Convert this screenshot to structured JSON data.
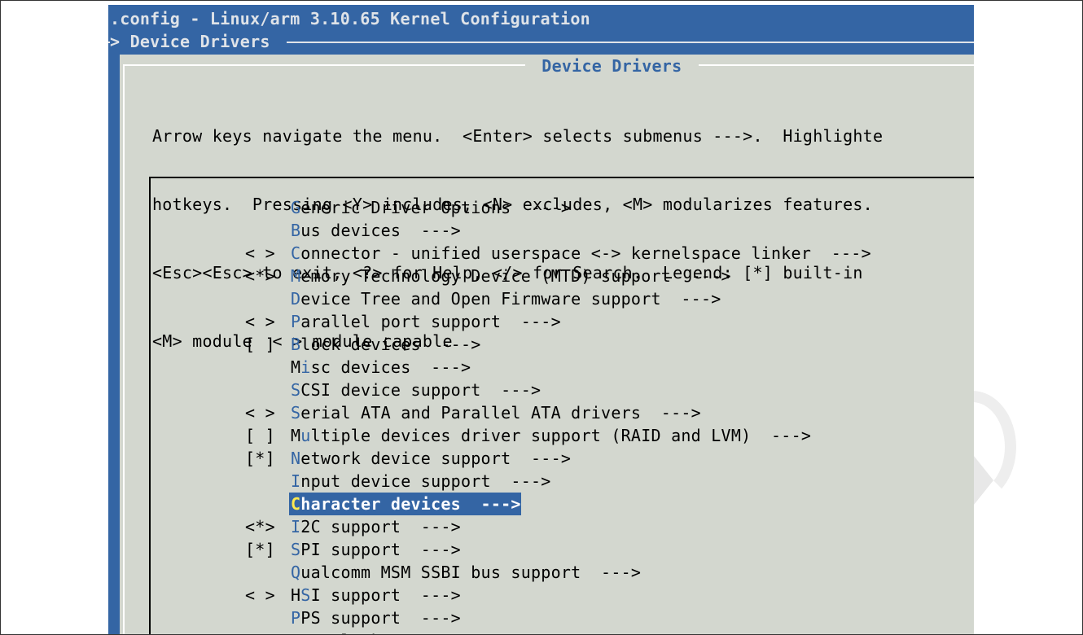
{
  "window": {
    "title": ".config - Linux/arm 3.10.65 Kernel Configuration",
    "breadcrumb": "> Device Drivers "
  },
  "dialog": {
    "title": " Device Drivers ",
    "help_lines": [
      "Arrow keys navigate the menu.  <Enter> selects submenus --->.  Highlighte",
      "hotkeys.  Pressing <Y> includes, <N> excludes, <M> modularizes features.",
      "<Esc><Esc> to exit, <?> for Help, </> for Search.  Legend: [*] built-in",
      "<M> module  < > module capable"
    ]
  },
  "menu": {
    "selected_index": 13,
    "items": [
      {
        "prefix": "    ",
        "pre": "",
        "hot": "G",
        "rest": "eneric Driver Options  --->"
      },
      {
        "prefix": "    ",
        "pre": "",
        "hot": "B",
        "rest": "us devices  --->"
      },
      {
        "prefix": "< > ",
        "pre": "",
        "hot": "C",
        "rest": "onnector - unified userspace <-> kernelspace linker  --->"
      },
      {
        "prefix": "<*> ",
        "pre": "",
        "hot": "M",
        "rest": "emory Technology Device (MTD) support  --->"
      },
      {
        "prefix": "    ",
        "pre": "",
        "hot": "D",
        "rest": "evice Tree and Open Firmware support  --->"
      },
      {
        "prefix": "< > ",
        "pre": "",
        "hot": "P",
        "rest": "arallel port support  --->"
      },
      {
        "prefix": "[ ] ",
        "pre": "",
        "hot": "B",
        "rest": "lock devices  --->"
      },
      {
        "prefix": "    ",
        "pre": "M",
        "hot": "i",
        "rest": "sc devices  --->"
      },
      {
        "prefix": "    ",
        "pre": "",
        "hot": "S",
        "rest": "CSI device support  --->"
      },
      {
        "prefix": "< > ",
        "pre": "",
        "hot": "S",
        "rest": "erial ATA and Parallel ATA drivers  --->"
      },
      {
        "prefix": "[ ] ",
        "pre": "M",
        "hot": "u",
        "rest": "ltiple devices driver support (RAID and LVM)  --->"
      },
      {
        "prefix": "[*] ",
        "pre": "",
        "hot": "N",
        "rest": "etwork device support  --->"
      },
      {
        "prefix": "    ",
        "pre": "",
        "hot": "I",
        "rest": "nput device support  --->"
      },
      {
        "prefix": "    ",
        "pre": "",
        "hot": "C",
        "rest": "haracter devices  --->"
      },
      {
        "prefix": "<*> ",
        "pre": "",
        "hot": "I",
        "rest": "2C support  --->"
      },
      {
        "prefix": "[*] ",
        "pre": "",
        "hot": "S",
        "rest": "PI support  --->"
      },
      {
        "prefix": "    ",
        "pre": "",
        "hot": "Q",
        "rest": "ualcomm MSM SSBI bus support  --->"
      },
      {
        "prefix": "< > ",
        "pre": "H",
        "hot": "S",
        "rest": "I support  --->"
      },
      {
        "prefix": "    ",
        "pre": "",
        "hot": "P",
        "rest": "PS support  --->"
      },
      {
        "prefix": "    ",
        "pre": "",
        "hot": "P",
        "rest": "TP clock support  --->"
      }
    ]
  },
  "colors": {
    "terminal_background": "#3465a4",
    "dialog_background": "#d3d7cf",
    "hotkey": "#3465a4",
    "selection_background": "#3465a4",
    "selection_hotkey": "#fce94f"
  }
}
